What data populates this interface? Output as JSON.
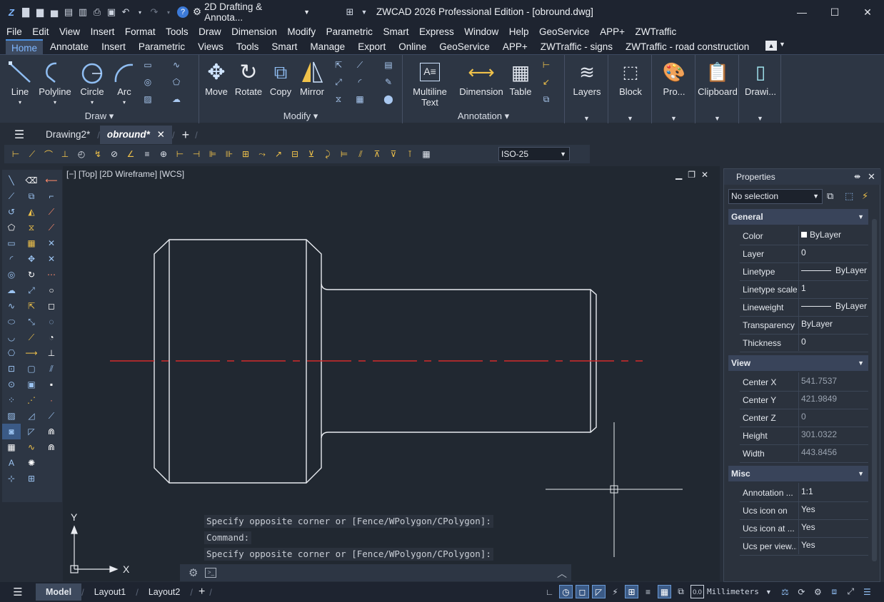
{
  "titlebar": {
    "workspace": "2D Drafting & Annota...",
    "title": "ZWCAD 2026 Professional Edition - [obround.dwg]"
  },
  "menu": [
    "File",
    "Edit",
    "View",
    "Insert",
    "Format",
    "Tools",
    "Draw",
    "Dimension",
    "Modify",
    "Parametric",
    "Smart",
    "Express",
    "Window",
    "Help",
    "GeoService",
    "APP+",
    "ZWTraffic"
  ],
  "ribbon_tabs": [
    "Home",
    "Annotate",
    "Insert",
    "Parametric",
    "Views",
    "Tools",
    "Smart",
    "Manage",
    "Export",
    "Online",
    "GeoService",
    "APP+",
    "ZWTraffic - signs",
    "ZWTraffic - road construction"
  ],
  "ribbon": {
    "draw": {
      "label": "Draw",
      "line": "Line",
      "polyline": "Polyline",
      "circle": "Circle",
      "arc": "Arc"
    },
    "modify": {
      "label": "Modify",
      "move": "Move",
      "rotate": "Rotate",
      "copy": "Copy",
      "mirror": "Mirror"
    },
    "annotation": {
      "label": "Annotation",
      "mtext1": "Multiline",
      "mtext2": "Text",
      "dimension": "Dimension",
      "table": "Table"
    },
    "layers": "Layers",
    "block": "Block",
    "pro": "Pro...",
    "clipboard": "Clipboard",
    "drawi": "Drawi..."
  },
  "doc_tabs": [
    "Drawing2*",
    "obround*"
  ],
  "dim_style": "ISO-25",
  "viewport": {
    "label": "[−] [Top] [2D Wireframe] [WCS]"
  },
  "ucs": {
    "x": "X",
    "y": "Y"
  },
  "command_lines": [
    "Specify opposite corner or [Fence/WPolygon/CPolygon]:",
    "Command:",
    "Specify opposite corner or [Fence/WPolygon/CPolygon]:"
  ],
  "properties": {
    "title": "Properties",
    "selection": "No selection",
    "general": {
      "title": "General",
      "rows": [
        {
          "k": "Color",
          "v": "ByLayer"
        },
        {
          "k": "Layer",
          "v": "0"
        },
        {
          "k": "Linetype",
          "v": "ByLayer"
        },
        {
          "k": "Linetype scale",
          "v": "1"
        },
        {
          "k": "Lineweight",
          "v": "ByLayer"
        },
        {
          "k": "Transparency",
          "v": "ByLayer"
        },
        {
          "k": "Thickness",
          "v": "0"
        }
      ]
    },
    "view": {
      "title": "View",
      "rows": [
        {
          "k": "Center X",
          "v": "541.7537"
        },
        {
          "k": "Center Y",
          "v": "421.9849"
        },
        {
          "k": "Center Z",
          "v": "0"
        },
        {
          "k": "Height",
          "v": "301.0322"
        },
        {
          "k": "Width",
          "v": "443.8456"
        }
      ]
    },
    "misc": {
      "title": "Misc",
      "rows": [
        {
          "k": "Annotation ...",
          "v": "1:1"
        },
        {
          "k": "Ucs icon on",
          "v": "Yes"
        },
        {
          "k": "Ucs icon at ...",
          "v": "Yes"
        },
        {
          "k": "Ucs per view...",
          "v": "Yes"
        }
      ]
    }
  },
  "status": {
    "tabs": [
      "Model",
      "Layout1",
      "Layout2"
    ],
    "units": "Millimeters"
  }
}
